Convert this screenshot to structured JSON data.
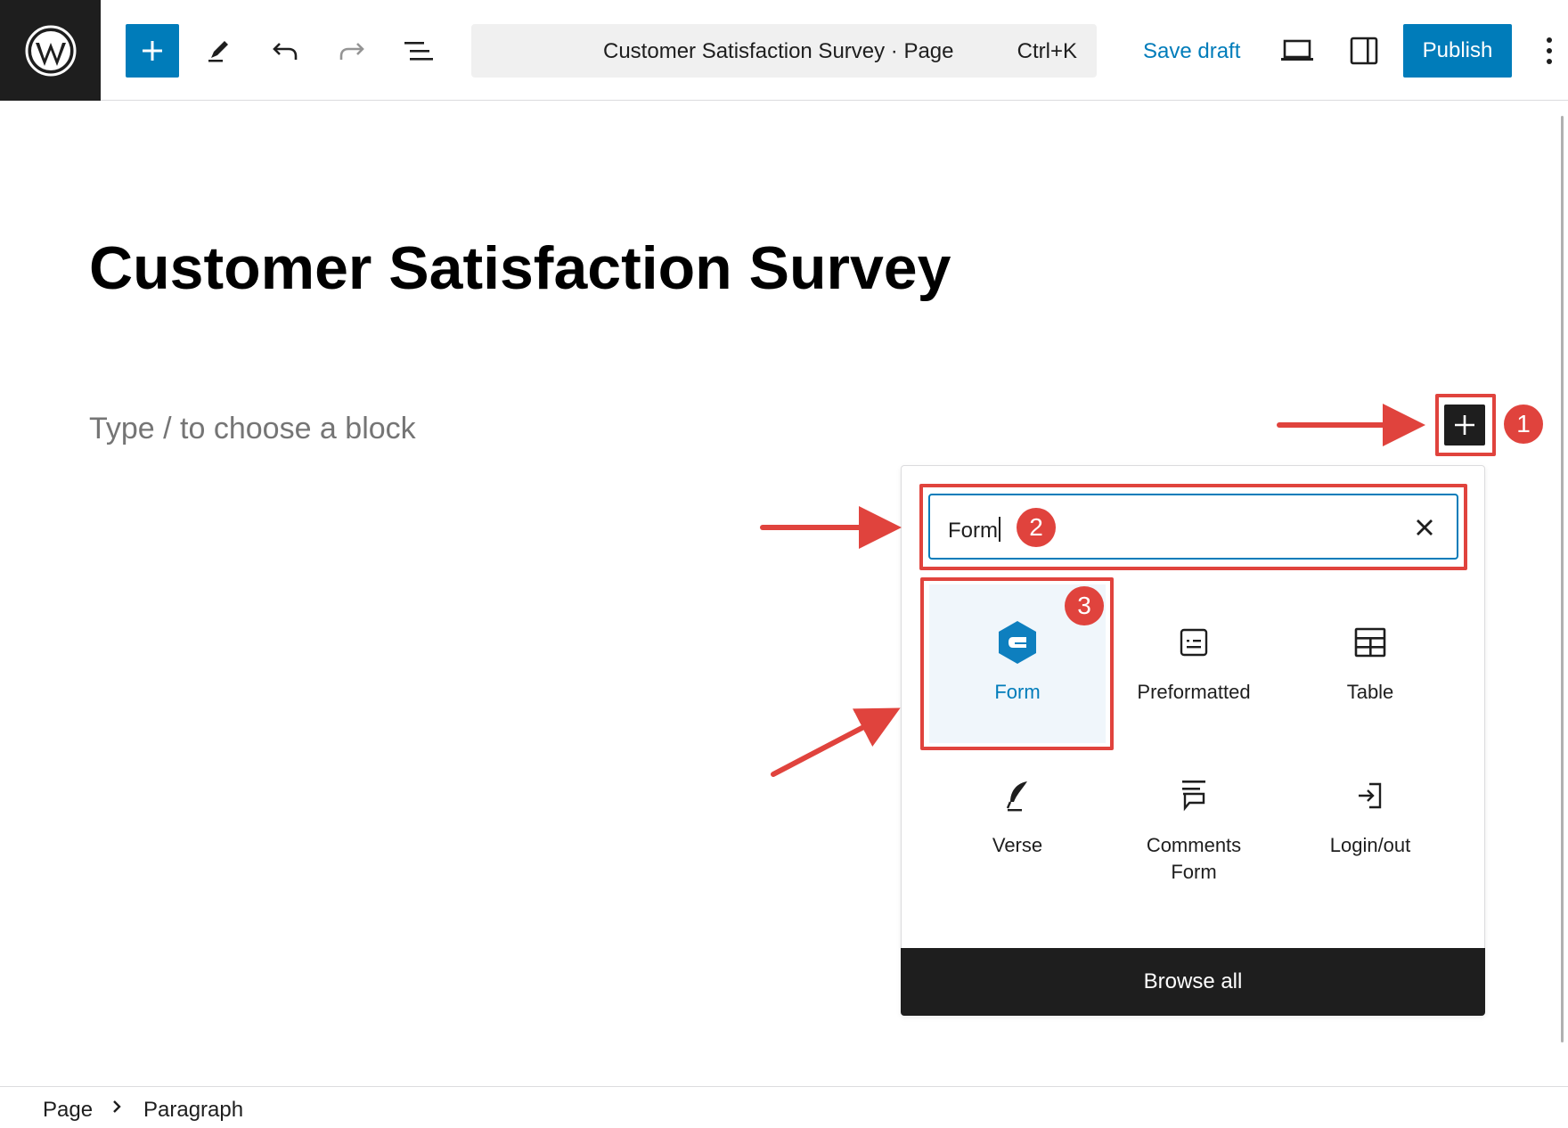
{
  "toolbar": {
    "document_title": "Customer Satisfaction Survey · Page",
    "shortcut": "Ctrl+K",
    "save_draft_label": "Save draft",
    "publish_label": "Publish",
    "accent_color": "#007cba"
  },
  "editor": {
    "page_title": "Customer Satisfaction Survey",
    "block_placeholder": "Type / to choose a block"
  },
  "inserter": {
    "search_value": "Form",
    "blocks": [
      {
        "label": "Form",
        "icon": "gravity-form-icon",
        "selected": true
      },
      {
        "label": "Preformatted",
        "icon": "preformatted-icon"
      },
      {
        "label": "Table",
        "icon": "table-icon"
      },
      {
        "label": "Verse",
        "icon": "feather-icon"
      },
      {
        "label": "Comments Form",
        "icon": "comments-form-icon"
      },
      {
        "label": "Login/out",
        "icon": "login-icon"
      }
    ],
    "browse_all_label": "Browse all"
  },
  "annotations": {
    "step1": "1",
    "step2": "2",
    "step3": "3",
    "color": "#e0433d"
  },
  "breadcrumb": {
    "items": [
      "Page",
      "Paragraph"
    ]
  }
}
